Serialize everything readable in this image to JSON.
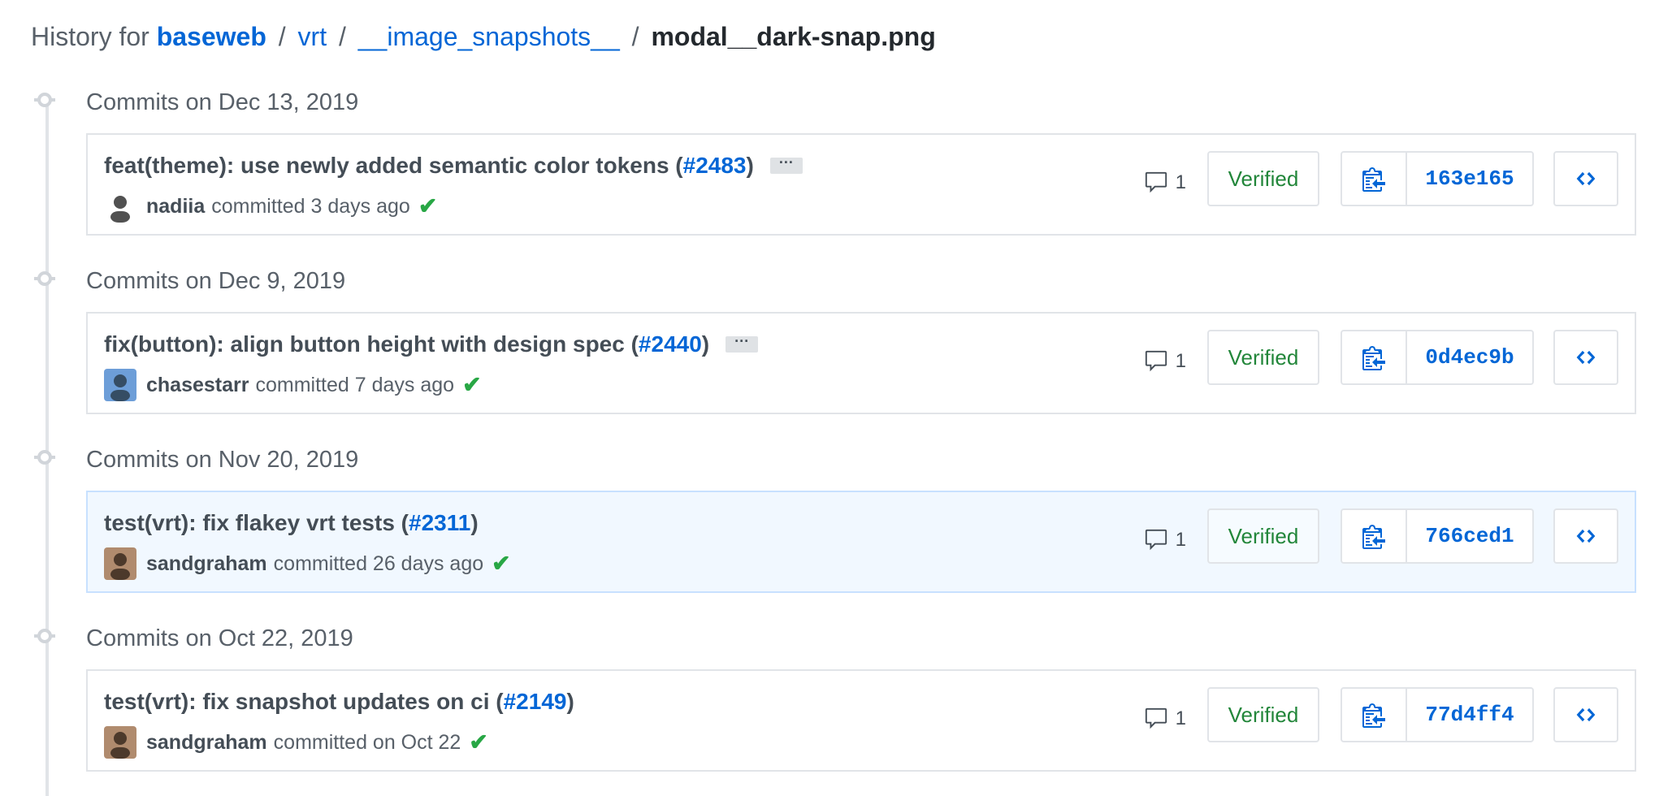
{
  "breadcrumb": {
    "prefix": "History for",
    "repo": "baseweb",
    "sep": "/",
    "path": [
      "vrt",
      "__image_snapshots__"
    ],
    "file": "modal__dark-snap.png"
  },
  "groups": [
    {
      "date_label": "Commits on Dec 13, 2019",
      "commit": {
        "title": "feat(theme): use newly added semantic color tokens (",
        "pr": "#2483",
        "title_end": ")",
        "has_ellipsis": true,
        "ellipsis": "···",
        "author": "nadiia",
        "committed": "committed 3 days ago",
        "check": "✔",
        "comments": "1",
        "verified": "Verified",
        "sha": "163e165",
        "highlight": false
      }
    },
    {
      "date_label": "Commits on Dec 9, 2019",
      "commit": {
        "title": "fix(button): align button height with design spec (",
        "pr": "#2440",
        "title_end": ")",
        "has_ellipsis": true,
        "ellipsis": "···",
        "author": "chasestarr",
        "committed": "committed 7 days ago",
        "check": "✔",
        "comments": "1",
        "verified": "Verified",
        "sha": "0d4ec9b",
        "highlight": false
      }
    },
    {
      "date_label": "Commits on Nov 20, 2019",
      "commit": {
        "title": "test(vrt): fix flakey vrt tests (",
        "pr": "#2311",
        "title_end": ")",
        "has_ellipsis": false,
        "ellipsis": "",
        "author": "sandgraham",
        "committed": "committed 26 days ago",
        "check": "✔",
        "comments": "1",
        "verified": "Verified",
        "sha": "766ced1",
        "highlight": true
      }
    },
    {
      "date_label": "Commits on Oct 22, 2019",
      "commit": {
        "title": "test(vrt): fix snapshot updates on ci (",
        "pr": "#2149",
        "title_end": ")",
        "has_ellipsis": false,
        "ellipsis": "",
        "author": "sandgraham",
        "committed": "committed on Oct 22",
        "check": "✔",
        "comments": "1",
        "verified": "Verified",
        "sha": "77d4ff4",
        "highlight": false
      }
    }
  ],
  "colors": {
    "link": "#0366d6",
    "verified": "#22863a",
    "check": "#28a745",
    "highlight_bg": "#f1f8ff"
  },
  "icons": {
    "comment": "comment-icon",
    "copy": "clipboard-icon",
    "browse": "code-icon",
    "check": "check-icon",
    "timeline": "git-commit-icon"
  }
}
